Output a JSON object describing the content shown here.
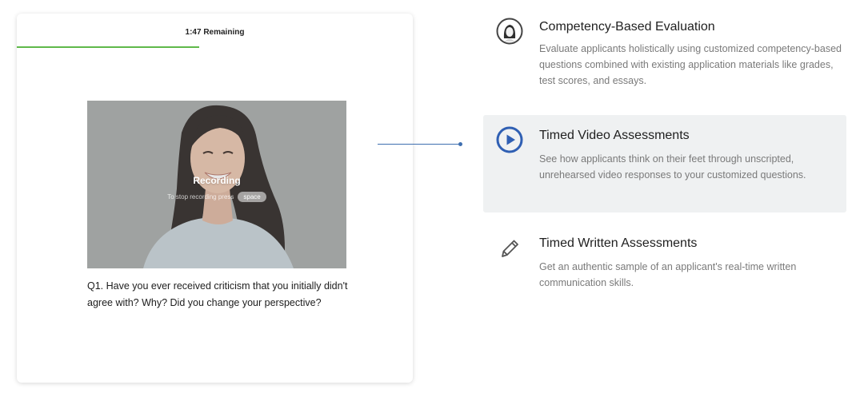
{
  "interview": {
    "timer": "1:47 Remaining",
    "progress": 0.46,
    "recording_label": "Recording",
    "stop_hint": "To stop recording press",
    "stop_key": "space",
    "question": "Q1. Have you ever received criticism that you initially didn't agree with? Why? Did you change your perspective?"
  },
  "features": [
    {
      "icon": "avatar-icon",
      "title": "Competency-Based Evaluation",
      "description": "Evaluate applicants holistically using customized competency-based questions combined with existing application materials like grades, test scores, and essays."
    },
    {
      "icon": "play-circle-icon",
      "title": "Timed Video Assessments",
      "description": "See how applicants think on their feet through unscripted, unrehearsed video responses to your customized questions.",
      "active": true
    },
    {
      "icon": "pencil-icon",
      "title": "Timed Written Assessments",
      "description": "Get an authentic sample of an applicant's real-time written communication skills."
    }
  ],
  "colors": {
    "progress": "#5fb94a",
    "accent": "#2f5fb3",
    "connector": "#3f6fb0",
    "active_bg": "#eff1f2"
  }
}
